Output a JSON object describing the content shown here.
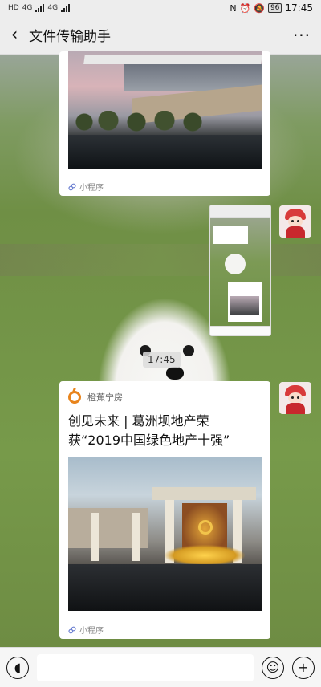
{
  "status_bar": {
    "network_left": "HD",
    "network_1": "4G",
    "network_2": "4G",
    "battery": "96",
    "time": "17:45"
  },
  "header": {
    "back_icon": "chevron-left-icon",
    "title": "文件传输助手",
    "more_icon": "more-dots-icon"
  },
  "messages": {
    "card1": {
      "footer_label": "小程序"
    },
    "timestamp": "17:45",
    "card2": {
      "brand_name": "橙蕉宁房",
      "title": "创见未来 | 葛洲坝地产荣获“2019中国绿色地产十强”",
      "footer_label": "小程序"
    }
  },
  "input_bar": {
    "voice_icon": "voice-icon",
    "input_value": "",
    "emoji_icon": "emoji-icon",
    "plus_icon": "plus-icon"
  },
  "colors": {
    "header_bg": "#ededed",
    "brand_orange": "#e8841c"
  }
}
